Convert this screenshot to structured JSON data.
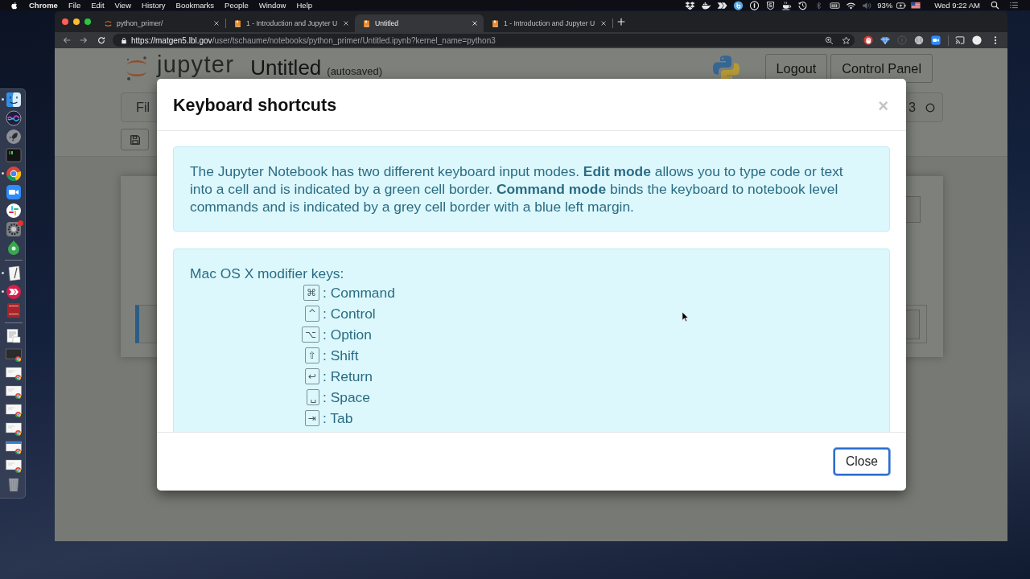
{
  "menu_bar": {
    "app_name": "Chrome",
    "menus": [
      "File",
      "Edit",
      "View",
      "History",
      "Bookmarks",
      "People",
      "Window",
      "Help"
    ],
    "status_icons": [
      {
        "kind": "open-box",
        "dimmed": false
      },
      {
        "kind": "whale",
        "dimmed": false
      },
      {
        "kind": "arrows",
        "dimmed": false
      },
      {
        "kind": "letter-disc",
        "dimmed": false
      },
      {
        "kind": "keyhole",
        "dimmed": false
      },
      {
        "kind": "shield",
        "dimmed": false
      },
      {
        "kind": "cup",
        "dimmed": false
      },
      {
        "kind": "history",
        "dimmed": false
      },
      {
        "kind": "bluetooth",
        "dimmed": true
      },
      {
        "kind": "meter",
        "dimmed": false
      },
      {
        "kind": "wifi",
        "dimmed": false
      },
      {
        "kind": "speaker",
        "dimmed": true
      }
    ],
    "battery": "93%",
    "charging": true,
    "clock": "Wed 9:22 AM"
  },
  "dock": {
    "groups": [
      [
        {
          "kind": "face",
          "running": true,
          "badge": false
        },
        {
          "kind": "sphere",
          "running": false,
          "badge": false
        },
        {
          "kind": "rocket",
          "running": false,
          "badge": false
        },
        {
          "kind": "terminal",
          "running": false,
          "badge": false
        },
        {
          "kind": "ring",
          "running": true,
          "badge": false
        },
        {
          "kind": "camera",
          "running": false,
          "badge": false
        },
        {
          "kind": "pinwheel",
          "running": false,
          "badge": false
        },
        {
          "kind": "gear",
          "running": false,
          "badge": true
        },
        {
          "kind": "droplet",
          "running": false,
          "badge": false
        }
      ],
      [
        {
          "kind": "paper-pen",
          "running": true,
          "badge": false
        },
        {
          "kind": "chevrons",
          "running": true,
          "badge": false
        },
        {
          "kind": "book",
          "running": false,
          "badge": false
        }
      ],
      [
        {
          "kind": "document",
          "running": false,
          "badge": false
        },
        {
          "kind": "window-dark",
          "running": false,
          "badge": false
        },
        {
          "kind": "window-light",
          "running": false,
          "badge": false
        },
        {
          "kind": "window-light",
          "running": false,
          "badge": false
        },
        {
          "kind": "window-light",
          "running": false,
          "badge": false
        },
        {
          "kind": "window-light",
          "running": false,
          "badge": false
        },
        {
          "kind": "window-blue",
          "running": false,
          "badge": false
        },
        {
          "kind": "window-light",
          "running": false,
          "badge": false
        },
        {
          "kind": "trash",
          "running": false,
          "badge": false
        }
      ]
    ]
  },
  "browser": {
    "tabs": [
      {
        "title": "python_primer/",
        "kind": "orbit",
        "selected": false
      },
      {
        "title": "1 - Introduction and Jupyter U",
        "kind": "book",
        "selected": false
      },
      {
        "title": "Untitled",
        "kind": "book",
        "selected": true
      },
      {
        "title": "1 - Introduction and Jupyter U",
        "kind": "book",
        "selected": false
      }
    ],
    "url": {
      "host": "https://matgen5.lbl.gov",
      "path": "/user/tschaume/notebooks/python_primer/Untitled.ipynb?kernel_name=python3"
    },
    "extensions": [
      {
        "kind": "hand",
        "dimmed": false
      },
      {
        "kind": "diamond",
        "dimmed": false
      },
      {
        "kind": "info",
        "dimmed": true
      },
      {
        "kind": "ball",
        "dimmed": false
      },
      {
        "kind": "camera",
        "dimmed": false
      }
    ]
  },
  "notebook": {
    "logo_text": "jupyter",
    "name": "Untitled",
    "save_status": "(autosaved)",
    "header_buttons": [
      "Logout",
      "Control Panel"
    ],
    "menu": [
      "Fil"
    ],
    "kernel_label": "3",
    "kernel_busy": false
  },
  "dialog": {
    "title": "Keyboard shortcuts",
    "close_symbol": "×",
    "intro": "The Jupyter Notebook has two different keyboard input modes. **Edit mode** allows you to type code or text into a cell and is indicated by a green cell border. **Command mode** binds the keyboard to notebook level commands and is indicated by a grey cell border with a blue left margin.",
    "modifier_heading": "Mac OS X modifier keys:",
    "modifier_keys": [
      {
        "key": "⌘",
        "label": ": Command"
      },
      {
        "key": "^",
        "label": ": Control"
      },
      {
        "key": "⌥",
        "label": ": Option"
      },
      {
        "key": "⇧",
        "label": ": Shift"
      },
      {
        "key": "↩",
        "label": ": Return"
      },
      {
        "key": "␣",
        "label": ": Space"
      },
      {
        "key": "⇥",
        "label": ": Tab"
      }
    ],
    "buttons": [
      {
        "label": "Close",
        "focused": true
      }
    ]
  }
}
